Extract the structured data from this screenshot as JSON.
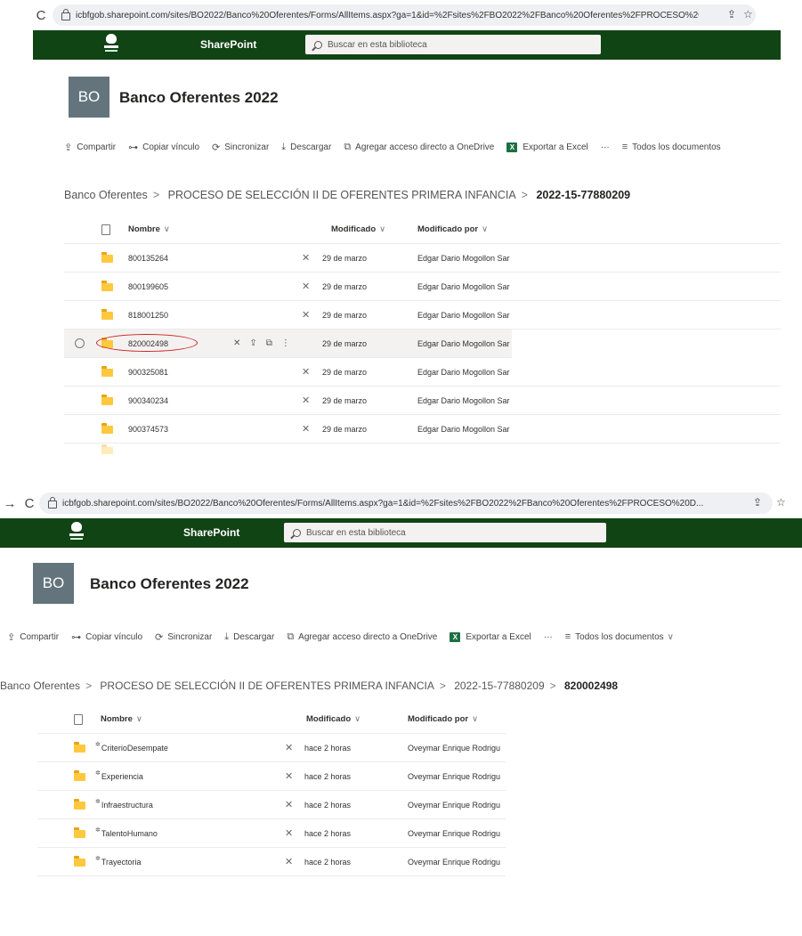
{
  "screen1": {
    "browser": {
      "back_icon": "→",
      "reload_icon": "C",
      "url": "icbfgob.sharepoint.com/sites/BO2022/Banco%20Oferentes/Forms/AllItems.aspx?ga=1&id=%2Fsites%2FBO2022%2FBanco%20Oferentes%2FPROCESO%20D...",
      "share_icon": "⇪",
      "star_icon": "☆"
    },
    "header": {
      "brand": "SharePoint",
      "search_placeholder": "Buscar en esta biblioteca"
    },
    "site": {
      "initials": "BO",
      "title": "Banco Oferentes 2022"
    },
    "commands": {
      "share": "Compartir",
      "copy_link": "Copiar vínculo",
      "sync": "Sincronizar",
      "download": "Descargar",
      "shortcut": "Agregar acceso directo a OneDrive",
      "excel": "Exportar a Excel",
      "more": "···",
      "view": "Todos los documentos"
    },
    "breadcrumb": [
      "Banco Oferentes",
      "PROCESO DE SELECCIÓN II DE OFERENTES PRIMERA INFANCIA"
    ],
    "breadcrumb_current": "2022-15-77880209",
    "columns": {
      "name": "Nombre",
      "modified": "Modificado",
      "modified_by": "Modificado por"
    },
    "rows": [
      {
        "name": "800135264",
        "modified": "29 de marzo",
        "modified_by": "Edgar Dario Mogollon Sar"
      },
      {
        "name": "800199605",
        "modified": "29 de marzo",
        "modified_by": "Edgar Dario Mogollon Sar"
      },
      {
        "name": "818001250",
        "modified": "29 de marzo",
        "modified_by": "Edgar Dario Mogollon Sar"
      },
      {
        "name": "820002498",
        "modified": "29 de marzo",
        "modified_by": "Edgar Dario Mogollon Sar"
      },
      {
        "name": "900325081",
        "modified": "29 de marzo",
        "modified_by": "Edgar Dario Mogollon Sar"
      },
      {
        "name": "900340234",
        "modified": "29 de marzo",
        "modified_by": "Edgar Dario Mogollon Sar"
      },
      {
        "name": "900374573",
        "modified": "29 de marzo",
        "modified_by": "Edgar Dario Mogollon Sar"
      }
    ]
  },
  "screen2": {
    "browser": {
      "back_icon": "→",
      "reload_icon": "C",
      "url": "icbfgob.sharepoint.com/sites/BO2022/Banco%20Oferentes/Forms/AllItems.aspx?ga=1&id=%2Fsites%2FBO2022%2FBanco%20Oferentes%2FPROCESO%20D...",
      "share_icon": "⇪",
      "star_icon": "☆"
    },
    "header": {
      "brand": "SharePoint",
      "search_placeholder": "Buscar en esta biblioteca"
    },
    "site": {
      "initials": "BO",
      "title": "Banco Oferentes 2022"
    },
    "commands": {
      "share": "Compartir",
      "copy_link": "Copiar vínculo",
      "sync": "Sincronizar",
      "download": "Descargar",
      "shortcut": "Agregar acceso directo a OneDrive",
      "excel": "Exportar a Excel",
      "more": "···",
      "view": "Todos los documentos"
    },
    "breadcrumb": [
      "Banco Oferentes",
      "PROCESO DE SELECCIÓN II DE OFERENTES PRIMERA INFANCIA",
      "2022-15-77880209"
    ],
    "breadcrumb_current": "820002498",
    "columns": {
      "name": "Nombre",
      "modified": "Modificado",
      "modified_by": "Modificado por"
    },
    "rows": [
      {
        "name": "CriterioDesempate",
        "modified": "hace 2 horas",
        "modified_by": "Oveymar Enrique Rodrigu"
      },
      {
        "name": "Experiencia",
        "modified": "hace 2 horas",
        "modified_by": "Oveymar Enrique Rodrigu"
      },
      {
        "name": "Infraestructura",
        "modified": "hace 2 horas",
        "modified_by": "Oveymar Enrique Rodrigu"
      },
      {
        "name": "TalentoHumano",
        "modified": "hace 2 horas",
        "modified_by": "Oveymar Enrique Rodrigu"
      },
      {
        "name": "Trayectoria",
        "modified": "hace 2 horas",
        "modified_by": "Oveymar Enrique Rodrigu"
      }
    ]
  }
}
